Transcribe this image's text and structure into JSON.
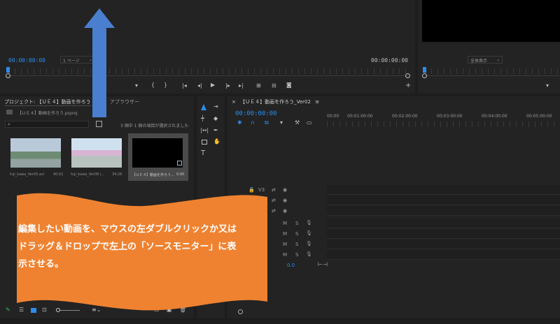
{
  "source_monitor": {
    "timecode_left": "00:00:00:00",
    "page_select": "1 ページ",
    "timecode_right": "00:00:00:00"
  },
  "program_monitor": {
    "fit_select": "全体表示"
  },
  "project_panel": {
    "tab_label": "プロジェクト: 【ＵＥ４】動画を作ろう",
    "menu_icon": "hamburger-icon",
    "browser_tab": "アブラウザー",
    "file_name": "【ＵＥ４】動画を作ろう.prproj",
    "selection_status": "3 個中 1 個の項目が選択されました",
    "clips": [
      {
        "name": "fuji_kawa_Ver05.avi",
        "duration": "40:01"
      },
      {
        "name": "fuji_kawa_Ver06 (...",
        "duration": "34:26"
      },
      {
        "name": "【ＵＥ４】動画を作ろう...",
        "duration": "0:00"
      }
    ]
  },
  "timeline": {
    "tab_label": "【ＵＥ４】動画を作ろう_Ver02",
    "close_icon": "close-icon",
    "timecode": "00:00:00:00",
    "ruler_labels": [
      "00:00",
      "00:01:00:00",
      "00:02:00:00",
      "00:03:00:00",
      "00:04:00:00",
      "00:05:00:00"
    ],
    "video_tracks": [
      "V3",
      "V2",
      "V1"
    ],
    "audio_tracks": [
      "A1",
      "A2",
      "A3",
      "A4"
    ],
    "mute_label": "M",
    "solo_label": "S",
    "volume_value": "0.0"
  },
  "callout": {
    "text_line1": "編集したい動画を、マウスの左ダブルクリックか又は",
    "text_line2": "ドラッグ＆ドロップで左上の「ソースモニター」に表",
    "text_line3": "示させる。",
    "color": "#ef8230"
  },
  "arrow": {
    "color": "#4a7fcf"
  }
}
